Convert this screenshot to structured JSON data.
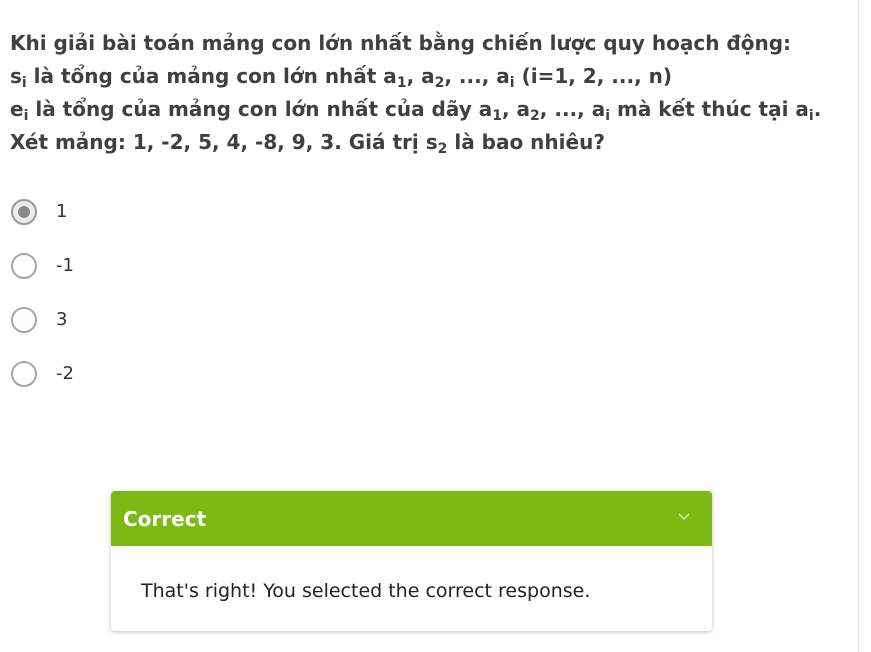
{
  "question": {
    "line1": "Khi giải bài toán mảng con lớn nhất bằng chiến lược quy hoạch động:",
    "line2": {
      "s": "s",
      "s_sub": "i",
      "text_a": " là tổng của mảng con lớn nhất a",
      "a1_sub": "1",
      "text_b": ", a",
      "a2_sub": "2",
      "text_c": ", ..., a",
      "ai_sub": "i",
      "text_d": " (i=1, 2, ..., n)"
    },
    "line3": {
      "e": "e",
      "e_sub": "i",
      "text_a": " là tổng của mảng con lớn nhất của dãy a",
      "a1_sub": "1",
      "text_b": ", a",
      "a2_sub": "2",
      "text_c": ", ..., a",
      "ai_sub": "i",
      "text_d": " mà kết thúc tại a",
      "ai2_sub": "i",
      "text_e": "."
    },
    "line4": {
      "text_a": "Xét mảng: 1, -2, 5, 4, -8, 9, 3. Giá trị s",
      "s_sub": "2",
      "text_b": " là bao nhiêu?"
    }
  },
  "choices": [
    {
      "label": "1",
      "selected": true
    },
    {
      "label": "-1",
      "selected": false
    },
    {
      "label": "3",
      "selected": false
    },
    {
      "label": "-2",
      "selected": false
    }
  ],
  "feedback": {
    "title": "Correct",
    "message": "That's right! You selected the correct response.",
    "header_color": "#7cb913",
    "icon": "chevron-down-icon"
  }
}
